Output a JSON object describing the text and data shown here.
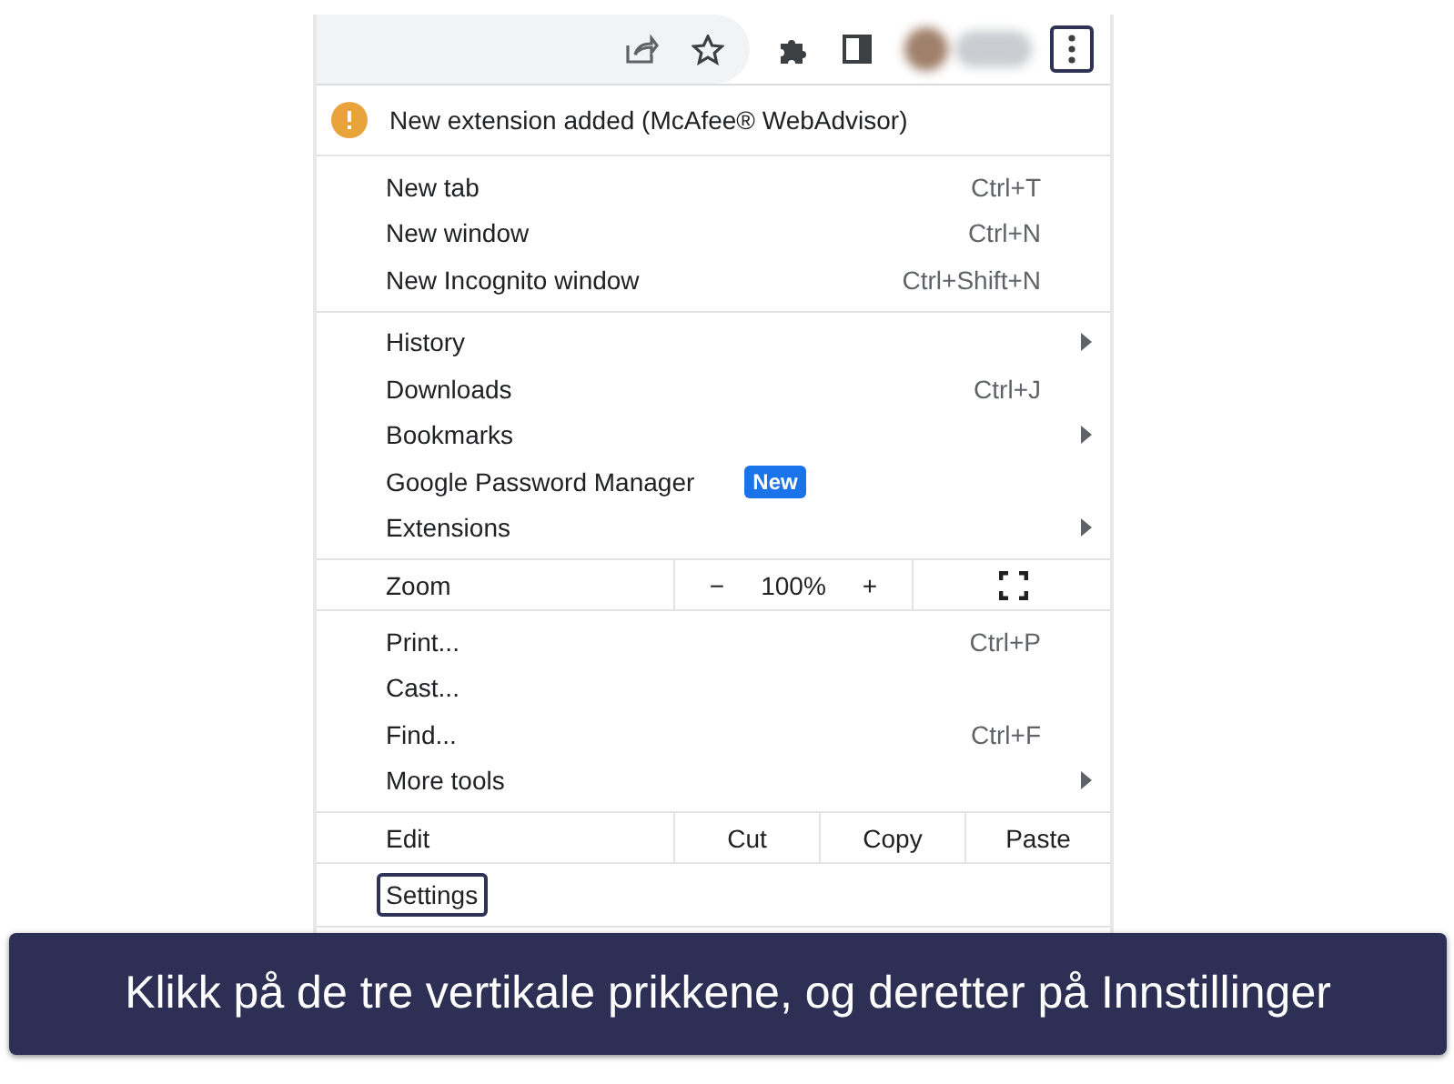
{
  "toolbar": {
    "menu_selected": true
  },
  "notice": {
    "text": "New extension added (McAfee® WebAdvisor)"
  },
  "sections": [
    {
      "kind": "list",
      "items": [
        {
          "label": "New tab",
          "shortcut": "Ctrl+T",
          "submenu": false,
          "highlighted": false
        },
        {
          "label": "New window",
          "shortcut": "Ctrl+N",
          "submenu": false,
          "highlighted": false
        },
        {
          "label": "New Incognito window",
          "shortcut": "Ctrl+Shift+N",
          "submenu": false,
          "highlighted": false
        }
      ]
    },
    {
      "kind": "list",
      "items": [
        {
          "label": "History",
          "submenu": true,
          "highlighted": false
        },
        {
          "label": "Downloads",
          "shortcut": "Ctrl+J",
          "submenu": false,
          "highlighted": false
        },
        {
          "label": "Bookmarks",
          "submenu": true,
          "highlighted": false
        },
        {
          "label": "Google Password Manager",
          "badge": "New",
          "submenu": false,
          "highlighted": false
        },
        {
          "label": "Extensions",
          "submenu": true,
          "highlighted": false
        }
      ]
    },
    {
      "kind": "zoom",
      "label": "Zoom",
      "minus": "−",
      "value": "100%",
      "plus": "+"
    },
    {
      "kind": "list",
      "items": [
        {
          "label": "Print...",
          "shortcut": "Ctrl+P",
          "submenu": false,
          "highlighted": false
        },
        {
          "label": "Cast...",
          "submenu": false,
          "highlighted": false
        },
        {
          "label": "Find...",
          "shortcut": "Ctrl+F",
          "submenu": false,
          "highlighted": false
        },
        {
          "label": "More tools",
          "submenu": true,
          "highlighted": false
        }
      ]
    },
    {
      "kind": "edit",
      "label": "Edit",
      "buttons": [
        "Cut",
        "Copy",
        "Paste"
      ]
    },
    {
      "kind": "list",
      "items": [
        {
          "label": "Settings",
          "submenu": false,
          "highlighted": true
        }
      ]
    }
  ],
  "caption": "Klikk på de tre vertikale prikkene, og deretter på Innstillinger"
}
